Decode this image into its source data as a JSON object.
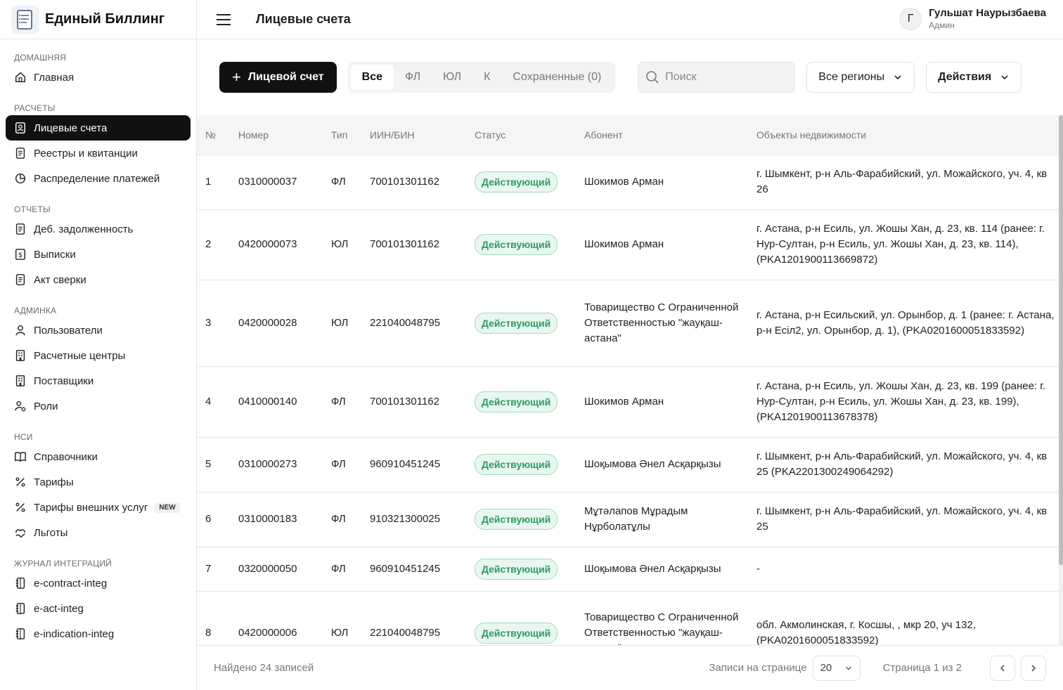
{
  "app": {
    "title": "Единый Биллинг"
  },
  "nav": {
    "sections": [
      {
        "heading": "Домашняя",
        "items": [
          {
            "label": "Главная",
            "icon": "home-icon"
          }
        ]
      },
      {
        "heading": "Расчеты",
        "items": [
          {
            "label": "Лицевые счета",
            "icon": "account-icon",
            "active": true
          },
          {
            "label": "Реестры и квитанции",
            "icon": "document-icon"
          },
          {
            "label": "Распределение платежей",
            "icon": "pie-icon"
          }
        ]
      },
      {
        "heading": "Отчеты",
        "items": [
          {
            "label": "Деб. задолженность",
            "icon": "document-icon"
          },
          {
            "label": "Выписки",
            "icon": "dollar-icon"
          },
          {
            "label": "Акт сверки",
            "icon": "document-icon"
          }
        ]
      },
      {
        "heading": "Админка",
        "items": [
          {
            "label": "Пользователи",
            "icon": "user-icon"
          },
          {
            "label": "Расчетные центры",
            "icon": "building-icon"
          },
          {
            "label": "Поставщики",
            "icon": "building-icon"
          },
          {
            "label": "Роли",
            "icon": "role-icon"
          }
        ]
      },
      {
        "heading": "НСИ",
        "items": [
          {
            "label": "Справочники",
            "icon": "book-icon"
          },
          {
            "label": "Тарифы",
            "icon": "percent-icon"
          },
          {
            "label": "Тарифы внешних услуг",
            "icon": "percent-icon",
            "badge": "NEW"
          },
          {
            "label": "Льготы",
            "icon": "benefit-icon"
          }
        ]
      },
      {
        "heading": "Журнал интеграций",
        "items": [
          {
            "label": "e-contract-integ",
            "icon": "notebook-icon"
          },
          {
            "label": "e-act-integ",
            "icon": "notebook-icon"
          },
          {
            "label": "e-indication-integ",
            "icon": "notebook-icon"
          }
        ]
      }
    ]
  },
  "header": {
    "page_title": "Лицевые счета",
    "user_initial": "Г",
    "user_name": "Гульшат Наурызбаева",
    "user_role": "Админ"
  },
  "toolbar": {
    "add_label": "Лицевой счет",
    "tabs": [
      "Все",
      "ФЛ",
      "ЮЛ",
      "К",
      "Сохраненные (0)"
    ],
    "active_tab": 0,
    "search_placeholder": "Поиск",
    "region_label": "Все регионы",
    "actions_label": "Действия"
  },
  "table": {
    "columns": [
      "№",
      "Номер",
      "Тип",
      "ИИН/БИН",
      "Статус",
      "Абонент",
      "Объекты недвижимости"
    ],
    "rows": [
      {
        "n": "1",
        "number": "0310000037",
        "type": "ФЛ",
        "iin": "700101301162",
        "status": "Действующий",
        "subscriber": "Шокимов Арман",
        "objects": "г. Шымкент, р-н Аль-Фарабийский, ул. Можайского, уч. 4, кв 26"
      },
      {
        "n": "2",
        "number": "0420000073",
        "type": "ЮЛ",
        "iin": "700101301162",
        "status": "Действующий",
        "subscriber": "Шокимов Арман",
        "objects": "г. Астана, р-н Есиль, ул. Жошы Хан, д. 23, кв. 114 (ранее: г. Нур-Султан, р-н Есиль, ул. Жошы Хан, д. 23, кв. 114), (PKA1201900113669872)"
      },
      {
        "n": "3",
        "number": "0420000028",
        "type": "ЮЛ",
        "iin": "221040048795",
        "status": "Действующий",
        "subscriber": "Товарищество С Ограниченной Ответственностью \"жауқаш-астана\"",
        "objects": "г. Астана, р-н Есильский, ул. Орынбор, д. 1 (ранее: г. Астана, р-н Есiл2, ул. Орынбор, д. 1), (PKA0201600051833592)"
      },
      {
        "n": "4",
        "number": "0410000140",
        "type": "ФЛ",
        "iin": "700101301162",
        "status": "Действующий",
        "subscriber": "Шокимов Арман",
        "objects": "г. Астана, р-н Есиль, ул. Жошы Хан, д. 23, кв. 199 (ранее: г. Нур-Султан, р-н Есиль, ул. Жошы Хан, д. 23, кв. 199), (PKA1201900113678378)"
      },
      {
        "n": "5",
        "number": "0310000273",
        "type": "ФЛ",
        "iin": "960910451245",
        "status": "Действующий",
        "subscriber": "Шоқымова Әнел Асқарқызы",
        "objects": "г. Шымкент, р-н Аль-Фарабийский, ул. Можайского, уч. 4, кв 25 (PKA2201300249064292)"
      },
      {
        "n": "6",
        "number": "0310000183",
        "type": "ФЛ",
        "iin": "910321300025",
        "status": "Действующий",
        "subscriber": "Мұтәлапов Мұрадым Нұрболатұлы",
        "objects": "г. Шымкент, р-н Аль-Фарабийский, ул. Можайского, уч. 4, кв 25"
      },
      {
        "n": "7",
        "number": "0320000050",
        "type": "ФЛ",
        "iin": "960910451245",
        "status": "Действующий",
        "subscriber": "Шоқымова Әнел Асқарқызы",
        "objects": "-"
      },
      {
        "n": "8",
        "number": "0420000006",
        "type": "ЮЛ",
        "iin": "221040048795",
        "status": "Действующий",
        "subscriber": "Товарищество С Ограниченной Ответственностью \"жауқаш-астана\"",
        "objects": "обл. Акмолинская, г. Косшы, , мкр 20, уч 132, (PKA0201600051833592)"
      }
    ]
  },
  "footer": {
    "found": "Найдено 24 записей",
    "per_page_label": "Записи на странице",
    "per_page_value": "20",
    "page_info": "Страница 1 из 2"
  },
  "colors": {
    "accent": "#111111",
    "status_bg": "#e8f7ef",
    "status_text": "#2f9a63"
  }
}
